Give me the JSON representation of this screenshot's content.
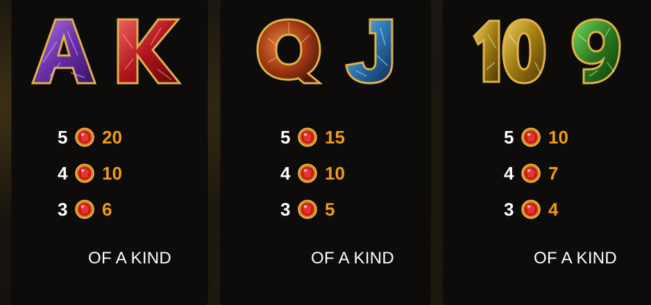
{
  "paytable": {
    "of_a_kind_label": "OF A KIND",
    "panels": [
      {
        "symbols": [
          {
            "glyph": "A",
            "icon": "purple-gem-letter-a-icon",
            "color": "#7a3fb8"
          },
          {
            "glyph": "K",
            "icon": "red-gem-letter-k-icon",
            "color": "#c4202a"
          }
        ],
        "rows": [
          {
            "count": "5",
            "amount": "20"
          },
          {
            "count": "4",
            "amount": "10"
          },
          {
            "count": "3",
            "amount": "6"
          }
        ]
      },
      {
        "symbols": [
          {
            "glyph": "Q",
            "icon": "orange-gem-letter-q-icon",
            "color": "#b0471c"
          },
          {
            "glyph": "J",
            "icon": "blue-gem-letter-j-icon",
            "color": "#2f86c4"
          }
        ],
        "rows": [
          {
            "count": "5",
            "amount": "15"
          },
          {
            "count": "4",
            "amount": "10"
          },
          {
            "count": "3",
            "amount": "5"
          }
        ]
      },
      {
        "symbols": [
          {
            "glyph": "10",
            "icon": "gold-gem-number-10-icon",
            "color": "#a8821c"
          },
          {
            "glyph": "9",
            "icon": "green-gem-number-9-icon",
            "color": "#2f7a22"
          }
        ],
        "rows": [
          {
            "count": "5",
            "amount": "10"
          },
          {
            "count": "4",
            "amount": "7"
          },
          {
            "count": "3",
            "amount": "4"
          }
        ]
      }
    ]
  },
  "colors": {
    "amount": "#f39b16",
    "count": "#ffffff",
    "gold_outline": "#e0b24a",
    "coin_gem": "#c81818"
  }
}
